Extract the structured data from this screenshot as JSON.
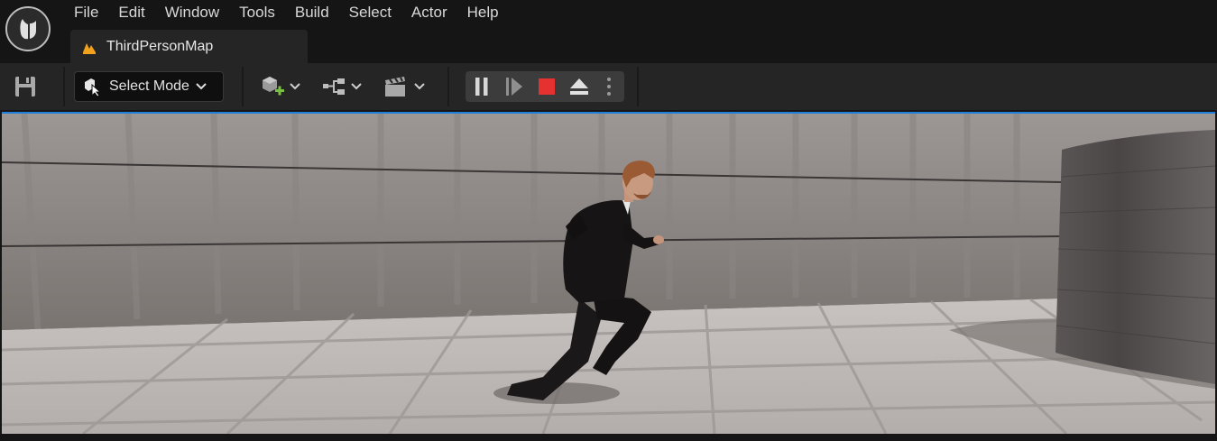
{
  "app": {
    "logo": "unreal-engine-logo"
  },
  "menu": {
    "items": [
      {
        "label": "File"
      },
      {
        "label": "Edit"
      },
      {
        "label": "Window"
      },
      {
        "label": "Tools"
      },
      {
        "label": "Build"
      },
      {
        "label": "Select"
      },
      {
        "label": "Actor"
      },
      {
        "label": "Help"
      }
    ]
  },
  "tab": {
    "label": "ThirdPersonMap",
    "icon": "level-map-icon"
  },
  "toolbar": {
    "save_icon": "save-icon",
    "mode_label": "Select Mode",
    "add_actor_icon": "add-actor-icon",
    "blueprint_icon": "blueprint-icon",
    "cinematics_icon": "cinematics-icon",
    "play_controls": [
      "pause-icon",
      "step-frame-icon",
      "stop-icon",
      "eject-icon",
      "more-options-icon"
    ]
  },
  "colors": {
    "accent": "#1f7fd8",
    "stop": "#e5312f",
    "add": "#7ac043",
    "tab_icon": "#f0a21c"
  },
  "viewport": {
    "scene": "third-person-character-running"
  }
}
